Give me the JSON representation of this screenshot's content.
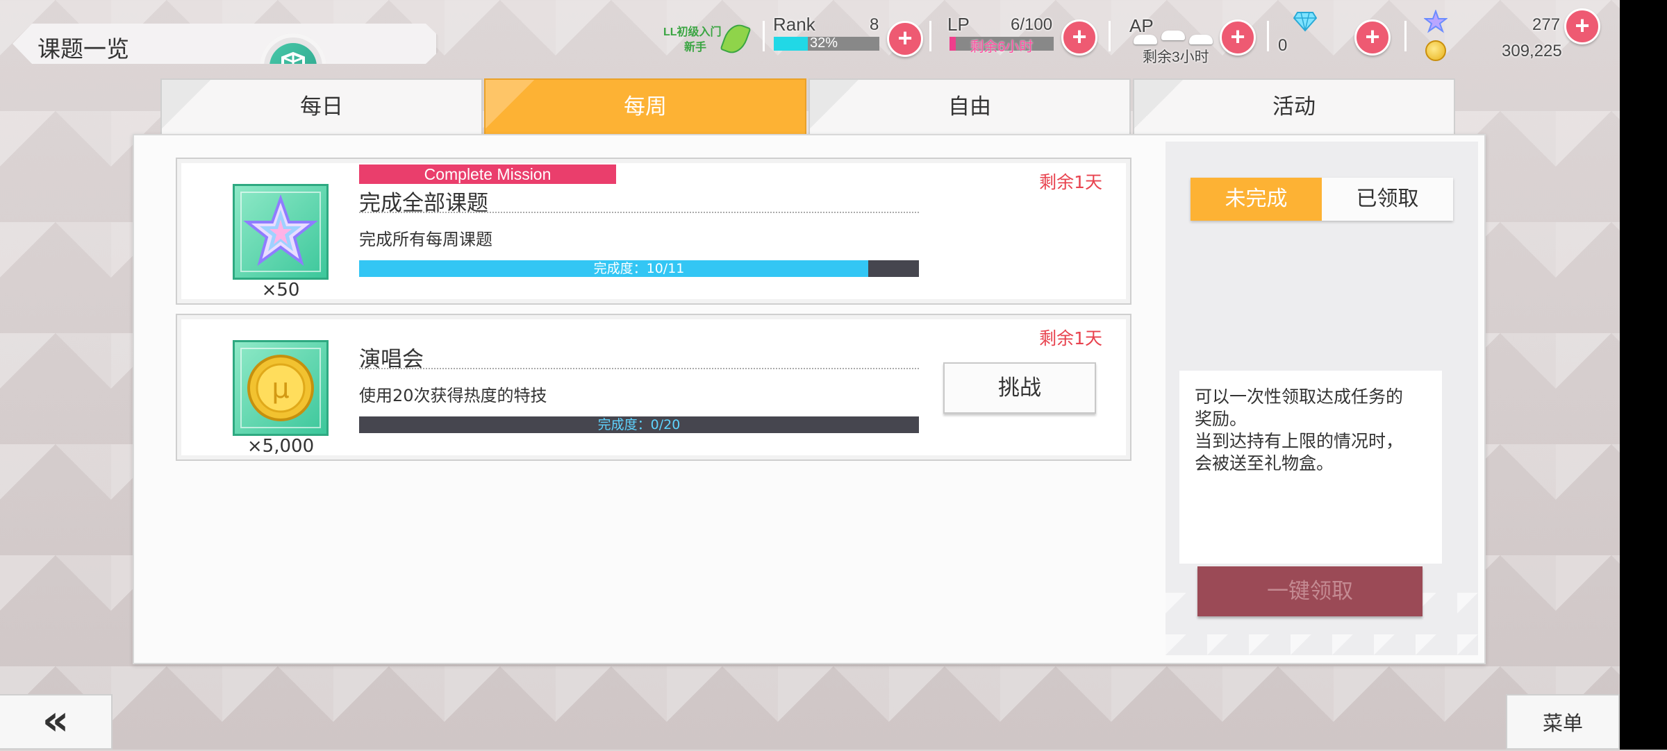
{
  "title": "课题一览",
  "header": {
    "badge": {
      "line1": "LL初级入门",
      "line2": "新手"
    },
    "rank": {
      "label": "Rank",
      "value": "8",
      "percent": 32,
      "percent_text": "32%"
    },
    "lp": {
      "label": "LP",
      "value": "6/100",
      "sub": "剩余6小时",
      "fill_fraction": 0.06
    },
    "ap": {
      "label": "AP",
      "sub": "剩余3小时"
    },
    "gems": {
      "value": "0"
    },
    "star_gems": {
      "value": "277"
    },
    "gold": {
      "value": "309,225"
    },
    "plus_symbol": "+"
  },
  "tabs": [
    {
      "label": "每日",
      "active": false
    },
    {
      "label": "每周",
      "active": true
    },
    {
      "label": "自由",
      "active": false
    },
    {
      "label": "活动",
      "active": false
    }
  ],
  "missions": [
    {
      "tag": "Complete Mission",
      "title": "完成全部课题",
      "description": "完成所有每周课题",
      "remaining": "剩余1天",
      "progress_text": "完成度：10/11",
      "progress_fraction": 0.909,
      "reward_icon": "star-gem-icon",
      "reward_qty": "×50"
    },
    {
      "title": "演唱会",
      "description": "使用20次获得热度的特技",
      "remaining": "剩余1天",
      "progress_text": "完成度：0/20",
      "progress_fraction": 0,
      "reward_icon": "gold-coin-icon",
      "reward_qty": "×5,000",
      "action_label": "挑战"
    }
  ],
  "side": {
    "filter_incomplete": "未完成",
    "filter_claimed": "已领取",
    "info_line1": "可以一次性领取达成任务的",
    "info_line2": "奖励。",
    "info_line3": "当到达持有上限的情况时，",
    "info_line4": "会被送至礼物盒。",
    "claim_all": "一键领取"
  },
  "nav": {
    "back": "«",
    "menu": "菜单"
  },
  "colors": {
    "accent": "#fdb234",
    "plus": "#ee5a72",
    "progress": "#33c6f4",
    "warn": "#e8424e"
  }
}
